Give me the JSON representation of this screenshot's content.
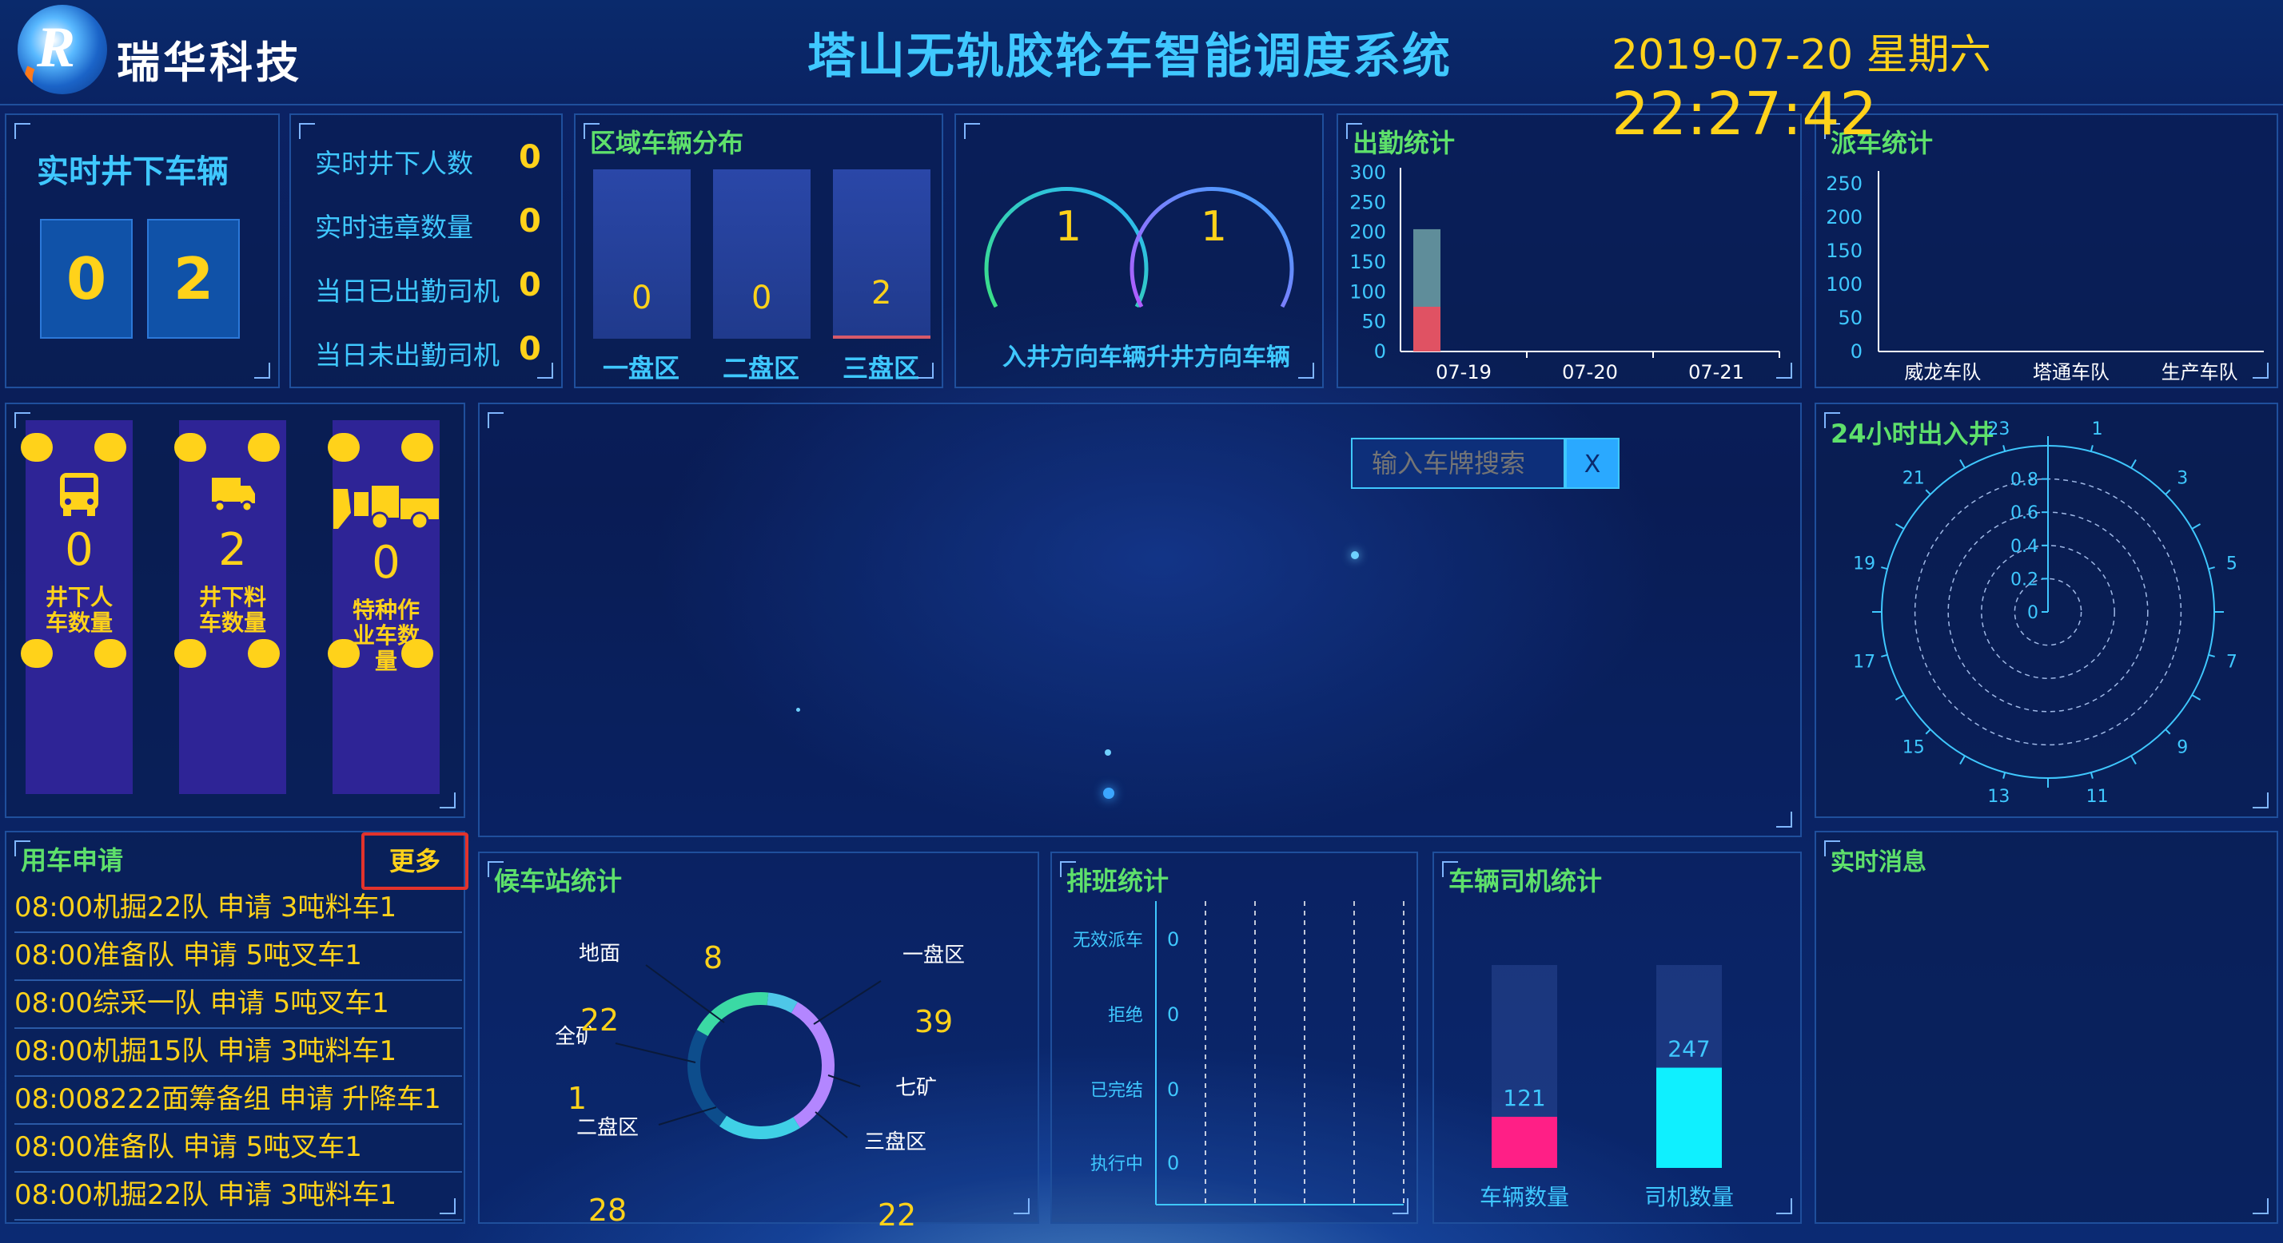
{
  "header": {
    "company": "瑞华科技",
    "title": "塔山无轨胶轮车智能调度系统",
    "date": "2019-07-20 星期六",
    "time": "22:27:42"
  },
  "realtime": {
    "title": "实时井下车辆",
    "digits": [
      "0",
      "2"
    ],
    "stats": [
      {
        "label": "实时井下人数",
        "value": "0"
      },
      {
        "label": "实时违章数量",
        "value": "0"
      },
      {
        "label": "当日已出勤司机",
        "value": "0"
      },
      {
        "label": "当日未出勤司机",
        "value": "0"
      }
    ]
  },
  "region": {
    "title": "区域车辆分布",
    "areas": [
      {
        "label": "一盘区",
        "value": "0"
      },
      {
        "label": "二盘区",
        "value": "0"
      },
      {
        "label": "三盘区",
        "value": "2"
      }
    ]
  },
  "direction": {
    "in_value": "1",
    "out_value": "1",
    "label": "入井方向车辆升井方向车辆"
  },
  "attendance": {
    "title": "出勤统计",
    "chart_data": {
      "type": "bar",
      "categories": [
        "07-19",
        "07-20",
        "07-21"
      ],
      "series": [
        {
          "values": [
            75,
            0,
            0
          ],
          "color": "#e05263"
        },
        {
          "values": [
            130,
            0,
            0
          ],
          "color": "#5f8d9a"
        }
      ],
      "y_ticks": [
        "300",
        "250",
        "200",
        "150",
        "100",
        "50",
        "0"
      ],
      "ylim": [
        0,
        300
      ],
      "stacked": true
    }
  },
  "dispatch": {
    "title": "派车统计",
    "chart_data": {
      "type": "bar",
      "categories": [
        "威龙车队",
        "塔通车队",
        "生产车队"
      ],
      "values": [
        0,
        0,
        0
      ],
      "y_ticks": [
        "250",
        "200",
        "150",
        "100",
        "50",
        "0"
      ],
      "ylim": [
        0,
        250
      ]
    }
  },
  "vehicle_types": [
    {
      "value": "0",
      "label": "井下人车数量",
      "icon": "bus-icon"
    },
    {
      "value": "2",
      "label": "井下料车数量",
      "icon": "truck-icon"
    },
    {
      "value": "0",
      "label": "特种作业车数量",
      "icon": "loader-icon"
    }
  ],
  "map": {
    "search_placeholder": "输入车牌搜索",
    "clear_label": "X"
  },
  "polar": {
    "title": "24小时出入井",
    "hours": [
      "23",
      "1",
      "3",
      "5",
      "7",
      "9",
      "11",
      "13",
      "15",
      "17",
      "19",
      "21"
    ],
    "r_ticks": [
      "0.8",
      "0.6",
      "0.4",
      "0.2",
      "0"
    ]
  },
  "applications": {
    "title": "用车申请",
    "more": "更多",
    "items": [
      "08:00机掘22队 申请 3吨料车1",
      "08:00准备队 申请 5吨叉车1",
      "08:00综采一队 申请 5吨叉车1",
      "08:00机掘15队 申请 3吨料车1",
      "08:008222面筹备组 申请 升降车1",
      "08:00准备队 申请 5吨叉车1",
      "08:00机掘22队 申请 3吨料车1"
    ]
  },
  "station": {
    "title": "候车站统计",
    "chart_data": {
      "type": "pie",
      "slices": [
        {
          "label": "地面",
          "value": 8,
          "color": "#4ec7e8"
        },
        {
          "label": "一盘区",
          "value": 39,
          "color": "#b386ff"
        },
        {
          "label": "七矿",
          "value": 0,
          "color": "#1f6fc7"
        },
        {
          "label": "三盘区",
          "value": 22,
          "color": "#3fd0e6"
        },
        {
          "label": "二盘区",
          "value": 28,
          "color": "#0d4d8c"
        },
        {
          "label": "全矿",
          "value": 22,
          "color": "#3bd9a4"
        }
      ],
      "value_labels": [
        "8",
        "39",
        "22",
        "28",
        "22",
        "1"
      ]
    }
  },
  "schedule": {
    "title": "排班统计",
    "chart_data": {
      "type": "bar",
      "categories": [
        "无效派车",
        "拒绝",
        "已完结",
        "执行中"
      ],
      "values": [
        0,
        0,
        0,
        0
      ]
    }
  },
  "vehicle_driver": {
    "title": "车辆司机统计",
    "chart_data": {
      "type": "bar",
      "categories": [
        "车辆数量",
        "司机数量"
      ],
      "values": [
        121,
        247
      ],
      "colors": [
        "#ff1f86",
        "#0ff0ff"
      ]
    }
  },
  "messages": {
    "title": "实时消息"
  }
}
